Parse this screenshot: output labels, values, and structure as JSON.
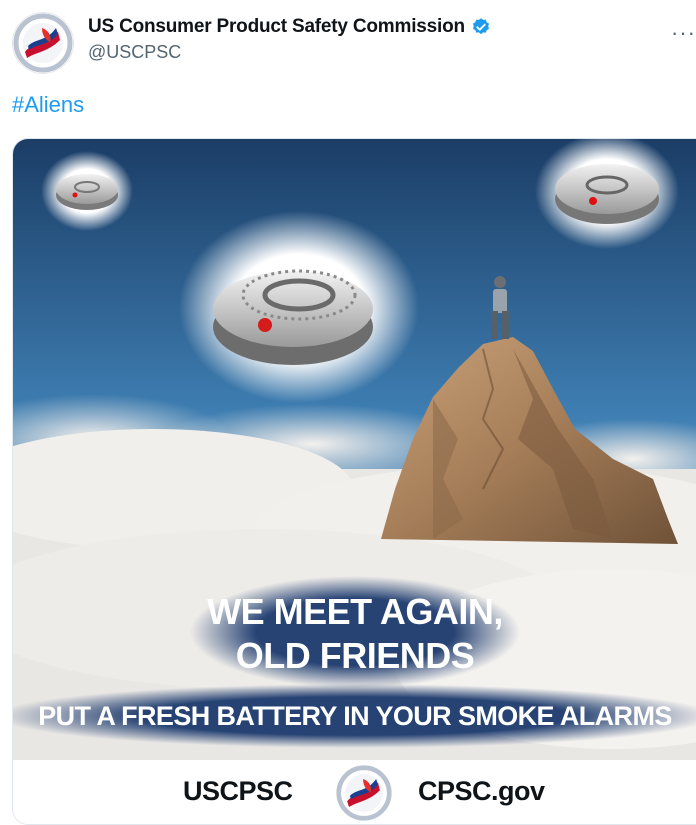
{
  "tweet": {
    "author_name": "US Consumer Product Safety Commission",
    "handle": "@USCPSC",
    "more_label": "···",
    "text": "#Aliens",
    "verified_icon": "verified-badge-icon",
    "avatar_icon": "cpsc-seal-icon"
  },
  "media": {
    "headline_line1": "WE MEET AGAIN,",
    "headline_line2": "OLD FRIENDS",
    "subline": "PUT A FRESH BATTERY IN YOUR SMOKE ALARMS",
    "footer_left": "USCPSC",
    "footer_right": "CPSC.gov",
    "footer_logo": "cpsc-seal-icon"
  },
  "colors": {
    "link": "#1d9bf0",
    "verified": "#1d9bf0",
    "text_primary": "#0f1419",
    "text_secondary": "#536471",
    "sky_top": "#1b3d66",
    "sky_mid": "#3f7fb3",
    "banner": "#1c3a6e"
  }
}
